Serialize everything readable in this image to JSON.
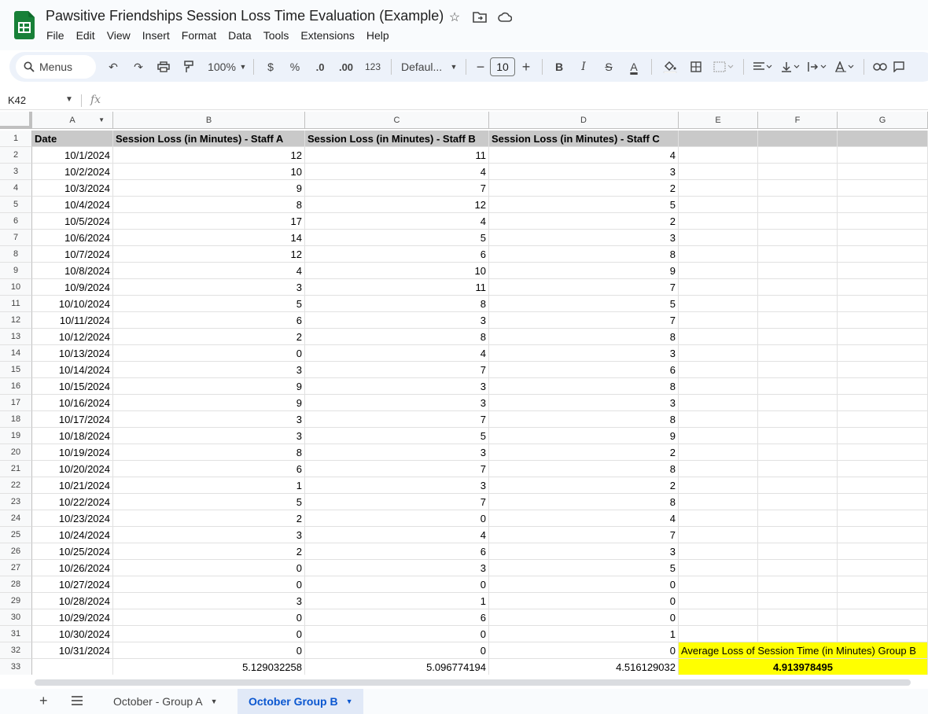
{
  "window": {
    "title": "Pawsitive Friendships Session Loss Time Evaluation (Example)"
  },
  "menu": [
    "File",
    "Edit",
    "View",
    "Insert",
    "Format",
    "Data",
    "Tools",
    "Extensions",
    "Help"
  ],
  "toolbar": {
    "search_label": "Menus",
    "zoom": "100%",
    "currency": "$",
    "percent": "%",
    "dec_decrease": ".0",
    "dec_increase": ".00",
    "number_format": "123",
    "font": "Defaul...",
    "font_size": "10",
    "bold": "B",
    "italic": "I",
    "strike": "S",
    "text_color": "A"
  },
  "formula_bar": {
    "cell_ref": "K42",
    "fx": "fx"
  },
  "columns": [
    "A",
    "B",
    "C",
    "D",
    "E",
    "F",
    "G"
  ],
  "header_row": [
    "Date",
    "Session Loss (in Minutes) - Staff A",
    "Session Loss (in Minutes) - Staff B",
    "Session Loss (in Minutes) - Staff C"
  ],
  "rows": [
    [
      "10/1/2024",
      "12",
      "11",
      "4"
    ],
    [
      "10/2/2024",
      "10",
      "4",
      "3"
    ],
    [
      "10/3/2024",
      "9",
      "7",
      "2"
    ],
    [
      "10/4/2024",
      "8",
      "12",
      "5"
    ],
    [
      "10/5/2024",
      "17",
      "4",
      "2"
    ],
    [
      "10/6/2024",
      "14",
      "5",
      "3"
    ],
    [
      "10/7/2024",
      "12",
      "6",
      "8"
    ],
    [
      "10/8/2024",
      "4",
      "10",
      "9"
    ],
    [
      "10/9/2024",
      "3",
      "11",
      "7"
    ],
    [
      "10/10/2024",
      "5",
      "8",
      "5"
    ],
    [
      "10/11/2024",
      "6",
      "3",
      "7"
    ],
    [
      "10/12/2024",
      "2",
      "8",
      "8"
    ],
    [
      "10/13/2024",
      "0",
      "4",
      "3"
    ],
    [
      "10/14/2024",
      "3",
      "7",
      "6"
    ],
    [
      "10/15/2024",
      "9",
      "3",
      "8"
    ],
    [
      "10/16/2024",
      "9",
      "3",
      "3"
    ],
    [
      "10/17/2024",
      "3",
      "7",
      "8"
    ],
    [
      "10/18/2024",
      "3",
      "5",
      "9"
    ],
    [
      "10/19/2024",
      "8",
      "3",
      "2"
    ],
    [
      "10/20/2024",
      "6",
      "7",
      "8"
    ],
    [
      "10/21/2024",
      "1",
      "3",
      "2"
    ],
    [
      "10/22/2024",
      "5",
      "7",
      "8"
    ],
    [
      "10/23/2024",
      "2",
      "0",
      "4"
    ],
    [
      "10/24/2024",
      "3",
      "4",
      "7"
    ],
    [
      "10/25/2024",
      "2",
      "6",
      "3"
    ],
    [
      "10/26/2024",
      "0",
      "3",
      "5"
    ],
    [
      "10/27/2024",
      "0",
      "0",
      "0"
    ],
    [
      "10/28/2024",
      "3",
      "1",
      "0"
    ],
    [
      "10/29/2024",
      "0",
      "6",
      "0"
    ],
    [
      "10/30/2024",
      "0",
      "0",
      "1"
    ],
    [
      "10/31/2024",
      "0",
      "0",
      "0"
    ]
  ],
  "averages_row": [
    "",
    "5.129032258",
    "5.096774194",
    "4.516129032"
  ],
  "summary": {
    "label": "Average Loss of Session Time (in Minutes) Group B",
    "value": "4.913978495"
  },
  "sheets": [
    {
      "name": "October - Group A",
      "active": false
    },
    {
      "name": "October Group B",
      "active": true
    }
  ],
  "colors": {
    "highlight": "#ffff00",
    "header_fill": "#c9c9c9",
    "active_tab": "#0b57d0"
  }
}
